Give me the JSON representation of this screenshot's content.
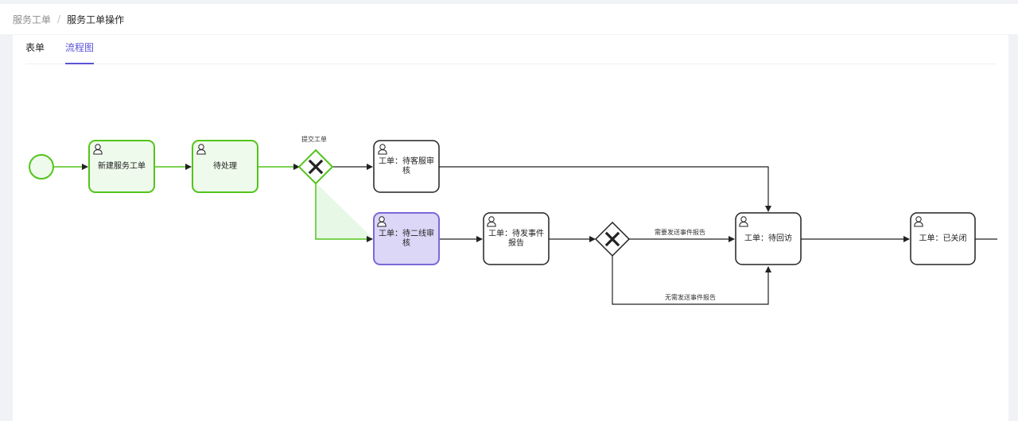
{
  "breadcrumb": {
    "parent": "服务工单",
    "separator": "/",
    "current": "服务工单操作"
  },
  "tabs": [
    {
      "label": "表单",
      "active": false
    },
    {
      "label": "流程图",
      "active": true
    }
  ],
  "colors": {
    "completed_stroke": "#52c41a",
    "completed_fill": "#eefaeb",
    "current_stroke": "#7b68d8",
    "current_fill": "#dcd6f7",
    "pending_stroke": "#222222",
    "accent": "#5b53d6"
  },
  "diagram": {
    "tasks": {
      "create": "新建服务工单",
      "pending": "待处理",
      "cs_review": "工单：待客服审核",
      "second_line_review": "工单：待二线审核",
      "event_report": "工单：待发事件报告",
      "revisit": "工单：待回访",
      "closed": "工单：已关闭"
    },
    "edges": {
      "submit": "提交工单",
      "need_report": "需要发送事件报告",
      "no_report": "无需发送事件报告"
    }
  }
}
